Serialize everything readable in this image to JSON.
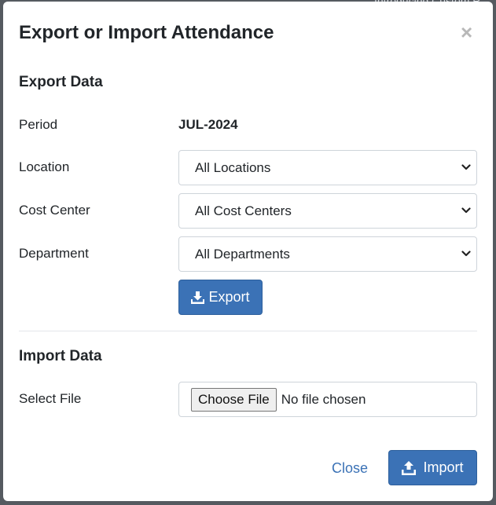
{
  "background": {
    "peek_text": "Introducing Custom R"
  },
  "modal": {
    "title": "Export or Import Attendance",
    "close_glyph": "×"
  },
  "export": {
    "section_title": "Export Data",
    "period_label": "Period",
    "period_value": "JUL-2024",
    "location_label": "Location",
    "location_value": "All Locations",
    "cost_center_label": "Cost Center",
    "cost_center_value": "All Cost Centers",
    "department_label": "Department",
    "department_value": "All Departments",
    "export_button": "Export",
    "export_icon": "download-icon"
  },
  "import": {
    "section_title": "Import Data",
    "file_label": "Select File",
    "choose_file_button": "Choose File",
    "file_status": "No file chosen"
  },
  "footer": {
    "close_label": "Close",
    "import_button": "Import",
    "import_icon": "upload-icon"
  },
  "colors": {
    "primary": "#3b72b6",
    "text": "#212529",
    "border": "#ced4da",
    "backdrop": "#555a60"
  }
}
